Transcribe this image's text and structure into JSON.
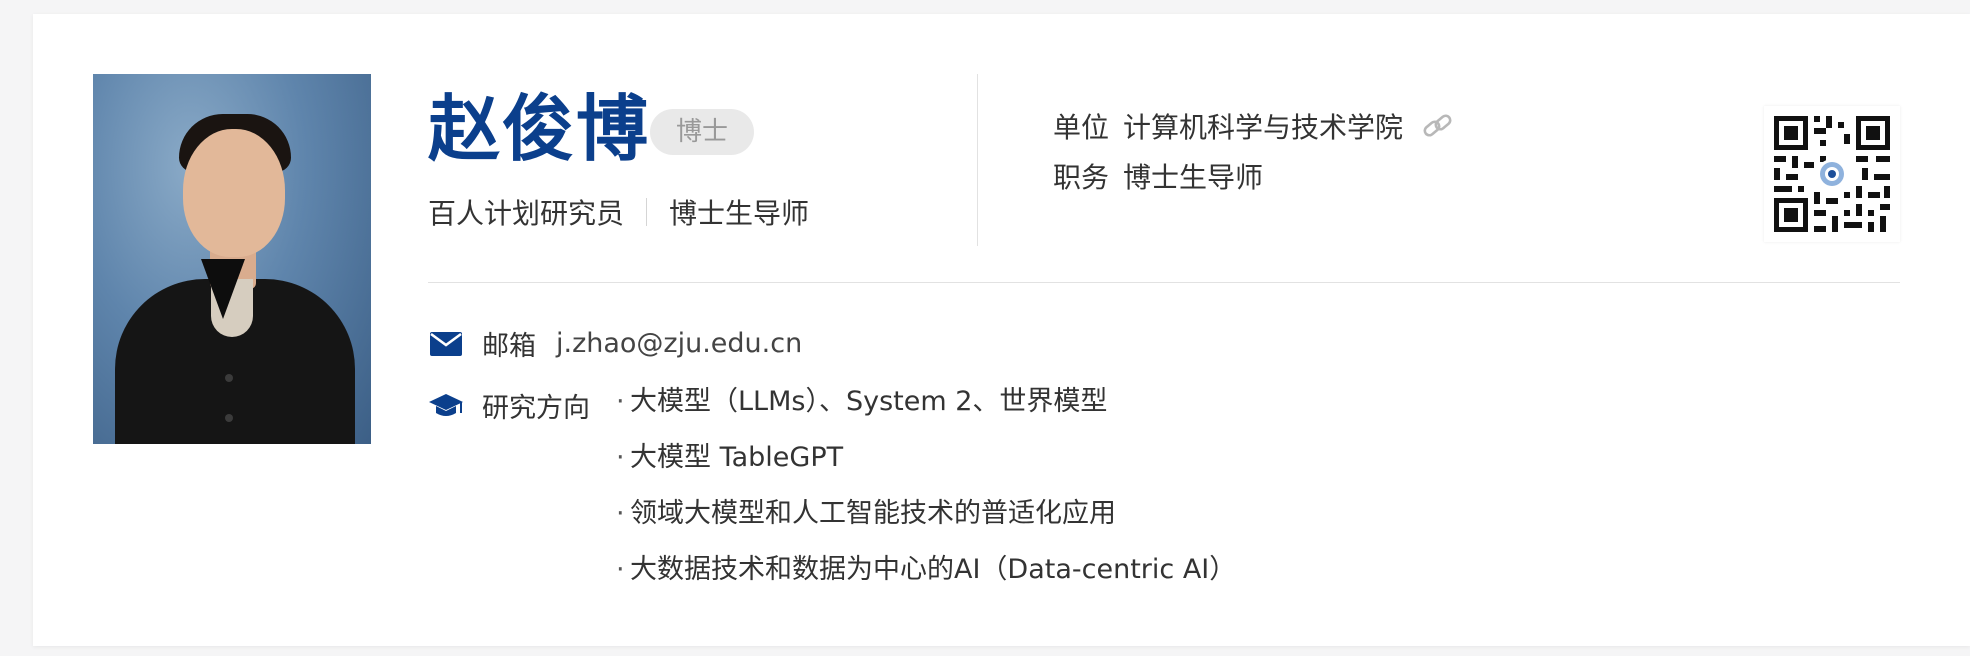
{
  "profile": {
    "name": "赵俊博",
    "degree": "博士",
    "titles": [
      "百人计划研究员",
      "博士生导师"
    ]
  },
  "info": {
    "unit_label": "单位",
    "unit_value": "计算机科学与技术学院",
    "post_label": "职务",
    "post_value": "博士生导师"
  },
  "contact": {
    "email_label": "邮箱",
    "email_value": "j.zhao@zju.edu.cn"
  },
  "research": {
    "label": "研究方向",
    "items": [
      "大模型（LLMs）、System 2、世界模型",
      "大模型 TableGPT",
      "领域大模型和人工智能技术的普适化应用",
      "大数据技术和数据为中心的AI（Data-centric AI）"
    ]
  },
  "icons": {
    "email": "envelope-icon",
    "research": "graduation-cap-icon",
    "link": "link-icon",
    "qr": "qr-code"
  },
  "colors": {
    "name": "#0b3f8c",
    "icon": "#0b3f8c",
    "badge_bg": "#e9e9e9",
    "badge_text": "#999999"
  }
}
